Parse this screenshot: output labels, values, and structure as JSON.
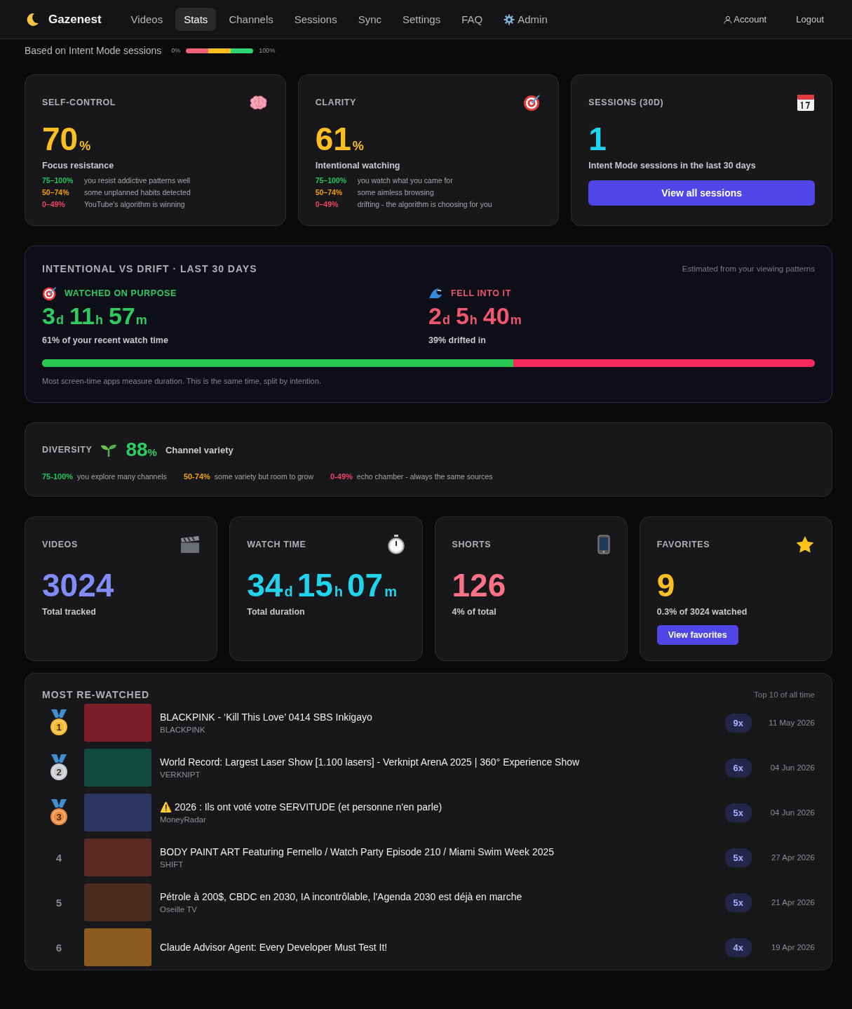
{
  "nav": {
    "brand": "Gazenest",
    "items": [
      {
        "label": "Videos",
        "selected": false,
        "kind": "plain"
      },
      {
        "label": "Stats",
        "selected": true,
        "kind": "plain"
      },
      {
        "label": "Channels",
        "selected": false,
        "kind": "plain"
      },
      {
        "label": "Sessions",
        "selected": false,
        "kind": "plain"
      },
      {
        "label": "Sync",
        "selected": false,
        "kind": "plain"
      },
      {
        "label": "Settings",
        "selected": false,
        "kind": "plain"
      },
      {
        "label": "FAQ",
        "selected": false,
        "kind": "plain"
      },
      {
        "label": "Admin",
        "selected": false,
        "kind": "admin"
      }
    ],
    "account": "Account",
    "logout": "Logout"
  },
  "intro": {
    "text": "Based on Intent Mode sessions",
    "scale_min": "0%",
    "scale_max": "100%"
  },
  "cards": [
    {
      "kind": "score",
      "title": "SELF-CONTROL",
      "value": "70",
      "unit": "%",
      "color": "#fbbf24",
      "caption": "Focus resistance",
      "legend": [
        {
          "range": "75–100%",
          "text": "you resist addictive patterns well",
          "color": "#22c55e"
        },
        {
          "range": "50–74%",
          "text": "some unplanned habits detected",
          "color": "#f59e0b"
        },
        {
          "range": "0–49%",
          "text": "YouTube's algorithm is winning",
          "color": "#ef4466"
        }
      ]
    },
    {
      "kind": "score",
      "title": "CLARITY",
      "value": "61",
      "unit": "%",
      "color": "#fbbf24",
      "caption": "Intentional watching",
      "legend": [
        {
          "range": "75–100%",
          "text": "you watch what you came for",
          "color": "#22c55e"
        },
        {
          "range": "50–74%",
          "text": "some aimless browsing",
          "color": "#f59e0b"
        },
        {
          "range": "0–49%",
          "text": "drifting - the algorithm is choosing for you",
          "color": "#ef4466"
        }
      ]
    },
    {
      "kind": "count",
      "title": "SESSIONS (30D)",
      "value": "1",
      "color": "#22d3ee",
      "caption": "Intent Mode sessions in the last 30 days",
      "button": "View all sessions"
    }
  ],
  "drift": {
    "title": "INTENTIONAL VS DRIFT · LAST 30 DAYS",
    "note": "Estimated from your viewing patterns",
    "purpose": {
      "label": "WATCHED ON PURPOSE",
      "parts": [
        {
          "value": "3",
          "unit": "d"
        },
        {
          "value": "11",
          "unit": "h"
        },
        {
          "value": "57",
          "unit": "m"
        }
      ],
      "caption": "61% of your recent watch time"
    },
    "fell": {
      "label": "FELL INTO IT",
      "parts": [
        {
          "value": "2",
          "unit": "d"
        },
        {
          "value": "5",
          "unit": "h"
        },
        {
          "value": "40",
          "unit": "m"
        }
      ],
      "caption": "39% drifted in"
    },
    "level": 0.61,
    "footnote": "Most screen-time apps measure duration. This is the same time, split by intention."
  },
  "diversity": {
    "title": "DIVERSITY",
    "value": "88",
    "unit": "%",
    "caption": "Channel variety",
    "legend": [
      {
        "range": "75-100%",
        "text": "you explore many channels",
        "color": "#22c55e"
      },
      {
        "range": "50-74%",
        "text": "some variety but room to grow",
        "color": "#f59e0b"
      },
      {
        "range": "0-49%",
        "text": "echo chamber - always the same sources",
        "color": "#ef4466"
      }
    ]
  },
  "stats": [
    {
      "title": "VIDEOS",
      "parts": [
        {
          "value": "3024"
        }
      ],
      "color": "#818cf8",
      "caption": "Total tracked"
    },
    {
      "title": "WATCH TIME",
      "parts": [
        {
          "value": "34",
          "unit": "d"
        },
        {
          "value": "15",
          "unit": "h"
        },
        {
          "value": "07",
          "unit": "m"
        }
      ],
      "color": "#22d3ee",
      "caption": "Total duration"
    },
    {
      "title": "SHORTS",
      "parts": [
        {
          "value": "126"
        }
      ],
      "color": "#fb7185",
      "caption": "4% of total"
    },
    {
      "title": "FAVORITES",
      "parts": [
        {
          "value": "9"
        }
      ],
      "color": "#fbbf24",
      "caption": "0.3% of 3024 watched",
      "button": "View favorites"
    }
  ],
  "rewatched": {
    "title": "MOST RE-WATCHED",
    "note": "Top 10 of all time",
    "rows": [
      {
        "kind": "medal",
        "rank": "1",
        "color": "#f5b82e",
        "title": "BLACKPINK - ‘Kill This Love’ 0414 SBS Inkigayo",
        "channel": "BLACKPINK",
        "count": "9x",
        "date": "11 May 2026"
      },
      {
        "kind": "medal",
        "rank": "2",
        "color": "#c9ccd1",
        "title": "World Record: Largest Laser Show [1.100 lasers] - Verknipt ArenA 2025 | 360° Experience Show",
        "channel": "VERKNIPT",
        "count": "6x",
        "date": "04 Jun 2026"
      },
      {
        "kind": "medal",
        "rank": "3",
        "color": "#f08a3c",
        "title": "⚠️ 2026 : Ils ont voté votre SERVITUDE (et personne n'en parle)",
        "channel": "MoneyRadar",
        "count": "5x",
        "date": "04 Jun 2026"
      },
      {
        "kind": "plain",
        "rank": "4",
        "title": "BODY PAINT ART Featuring Fernello / Watch Party Episode 210 / Miami Swim Week 2025",
        "channel": "SHIFT",
        "count": "5x",
        "date": "27 Apr 2026"
      },
      {
        "kind": "plain",
        "rank": "5",
        "title": "Pétrole à 200$, CBDC en 2030, IA incontrôlable, l'Agenda 2030 est déjà en marche",
        "channel": "Oseille TV",
        "count": "5x",
        "date": "21 Apr 2026"
      },
      {
        "kind": "plain",
        "rank": "6",
        "title": "Claude Advisor Agent: Every Developer Must Test It!",
        "count": "4x",
        "date": "19 Apr 2026"
      }
    ]
  }
}
